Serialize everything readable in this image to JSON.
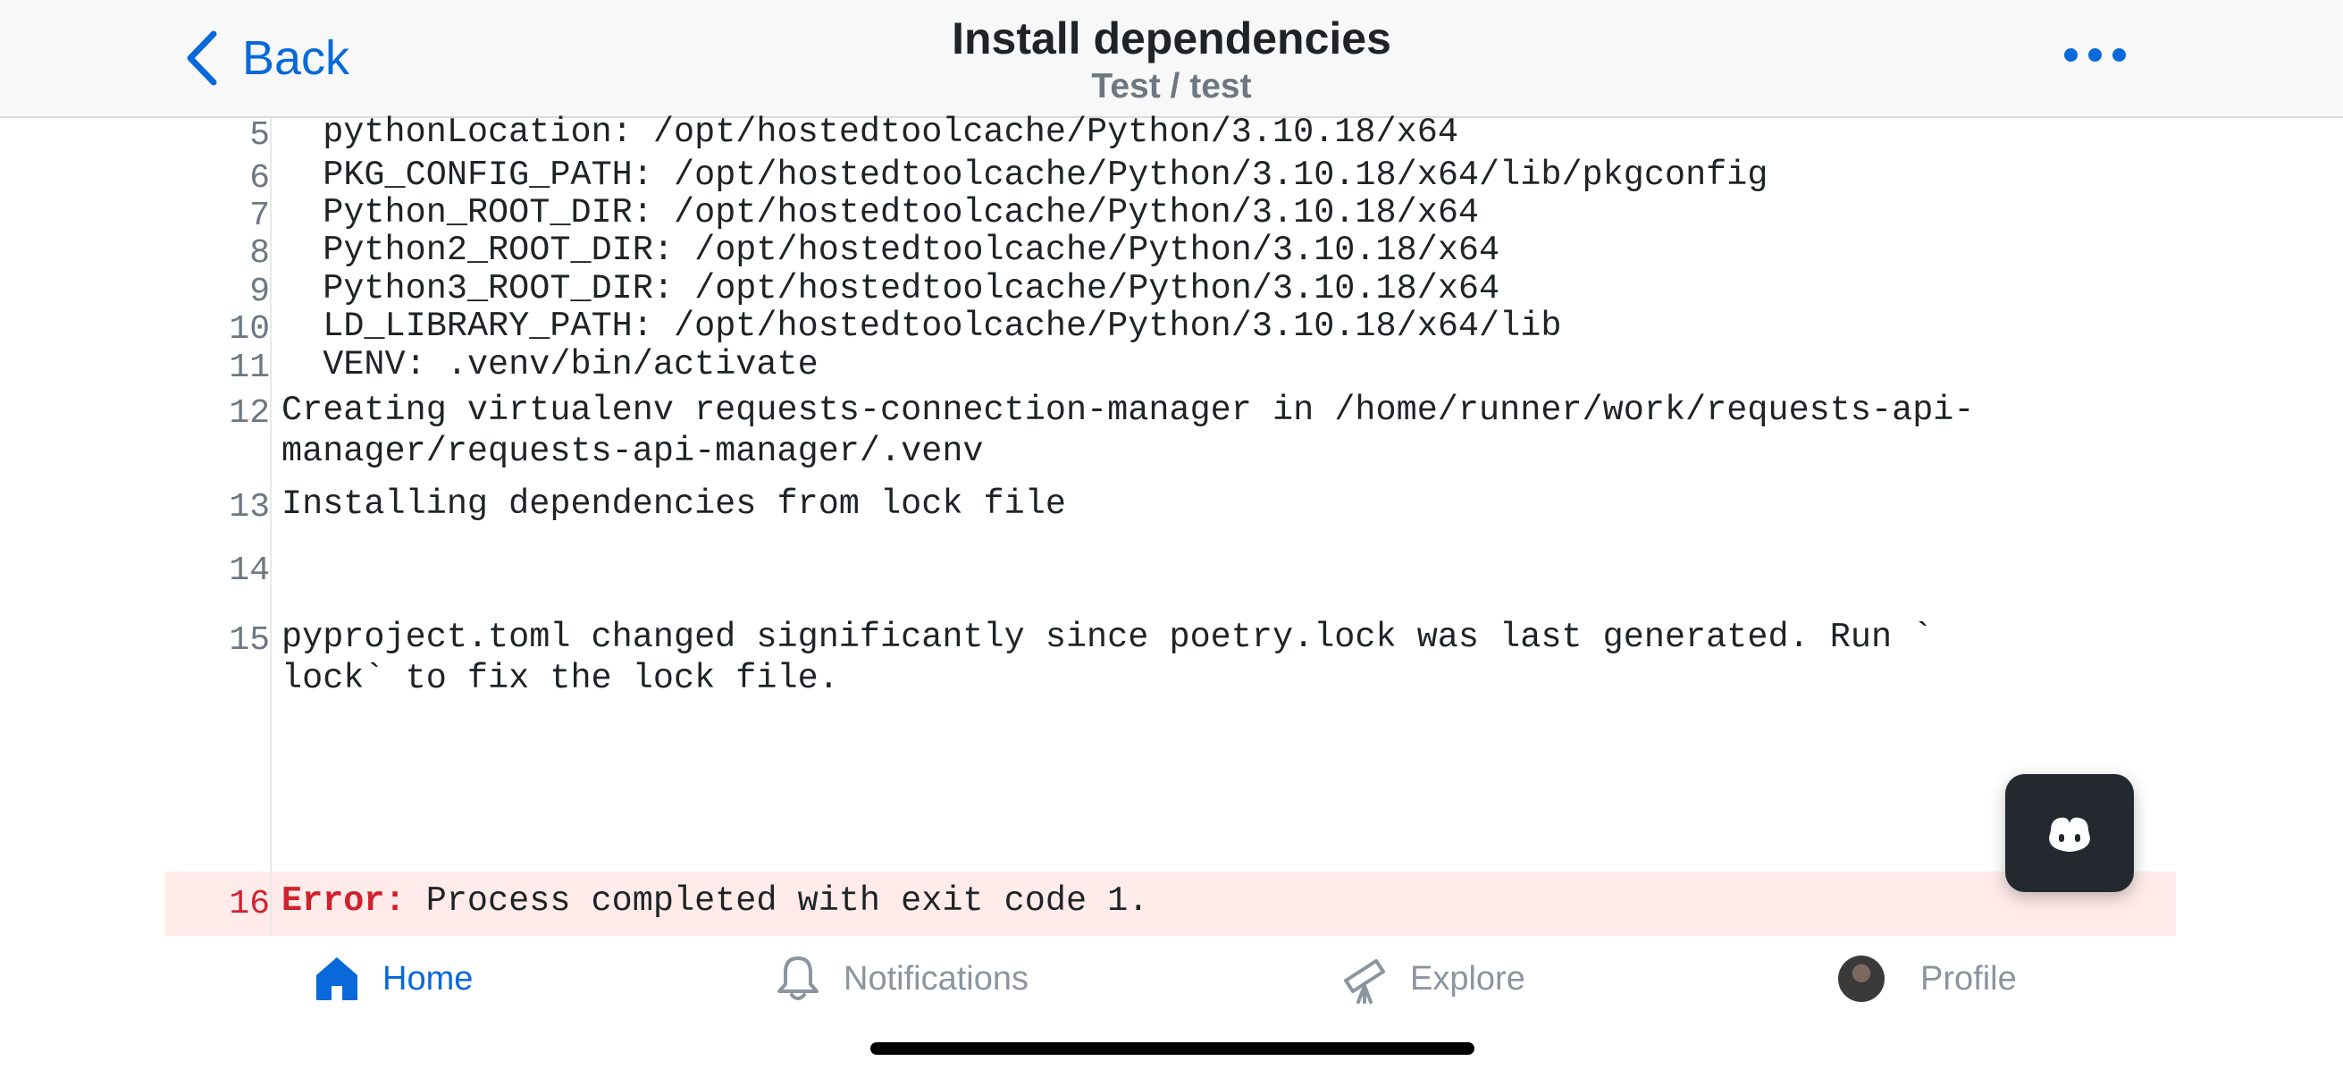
{
  "header": {
    "back_label": "Back",
    "title": "Install dependencies",
    "subtitle": "Test / test"
  },
  "log": {
    "lines": [
      {
        "n": "5",
        "text": "  pythonLocation: /opt/hostedtoolcache/Python/3.10.18/x64"
      },
      {
        "n": "6",
        "text": "  PKG_CONFIG_PATH: /opt/hostedtoolcache/Python/3.10.18/x64/lib/pkgconfig"
      },
      {
        "n": "7",
        "text": "  Python_ROOT_DIR: /opt/hostedtoolcache/Python/3.10.18/x64"
      },
      {
        "n": "8",
        "text": "  Python2_ROOT_DIR: /opt/hostedtoolcache/Python/3.10.18/x64"
      },
      {
        "n": "9",
        "text": "  Python3_ROOT_DIR: /opt/hostedtoolcache/Python/3.10.18/x64"
      },
      {
        "n": "10",
        "text": "  LD_LIBRARY_PATH: /opt/hostedtoolcache/Python/3.10.18/x64/lib"
      },
      {
        "n": "11",
        "text": "  VENV: .venv/bin/activate"
      },
      {
        "n": "12",
        "text": "Creating virtualenv requests-connection-manager in /home/runner/work/requests-api-\nmanager/requests-api-manager/.venv"
      },
      {
        "n": "13",
        "text": "Installing dependencies from lock file"
      },
      {
        "n": "14",
        "text": ""
      },
      {
        "n": "15",
        "text": "pyproject.toml changed significantly since poetry.lock was last generated. Run `\nlock` to fix the lock file."
      },
      {
        "n": "16",
        "error_prefix": "Error:",
        "text": " Process completed with exit code 1."
      }
    ]
  },
  "tabs": [
    {
      "label": "Home",
      "icon": "home-icon",
      "active": true
    },
    {
      "label": "Notifications",
      "icon": "bell-icon",
      "active": false
    },
    {
      "label": "Explore",
      "icon": "telescope-icon",
      "active": false
    },
    {
      "label": "Profile",
      "icon": "avatar",
      "active": false
    }
  ],
  "colors": {
    "accent": "#0969da",
    "error": "#cf222e",
    "error_bg": "#ffebe9"
  }
}
